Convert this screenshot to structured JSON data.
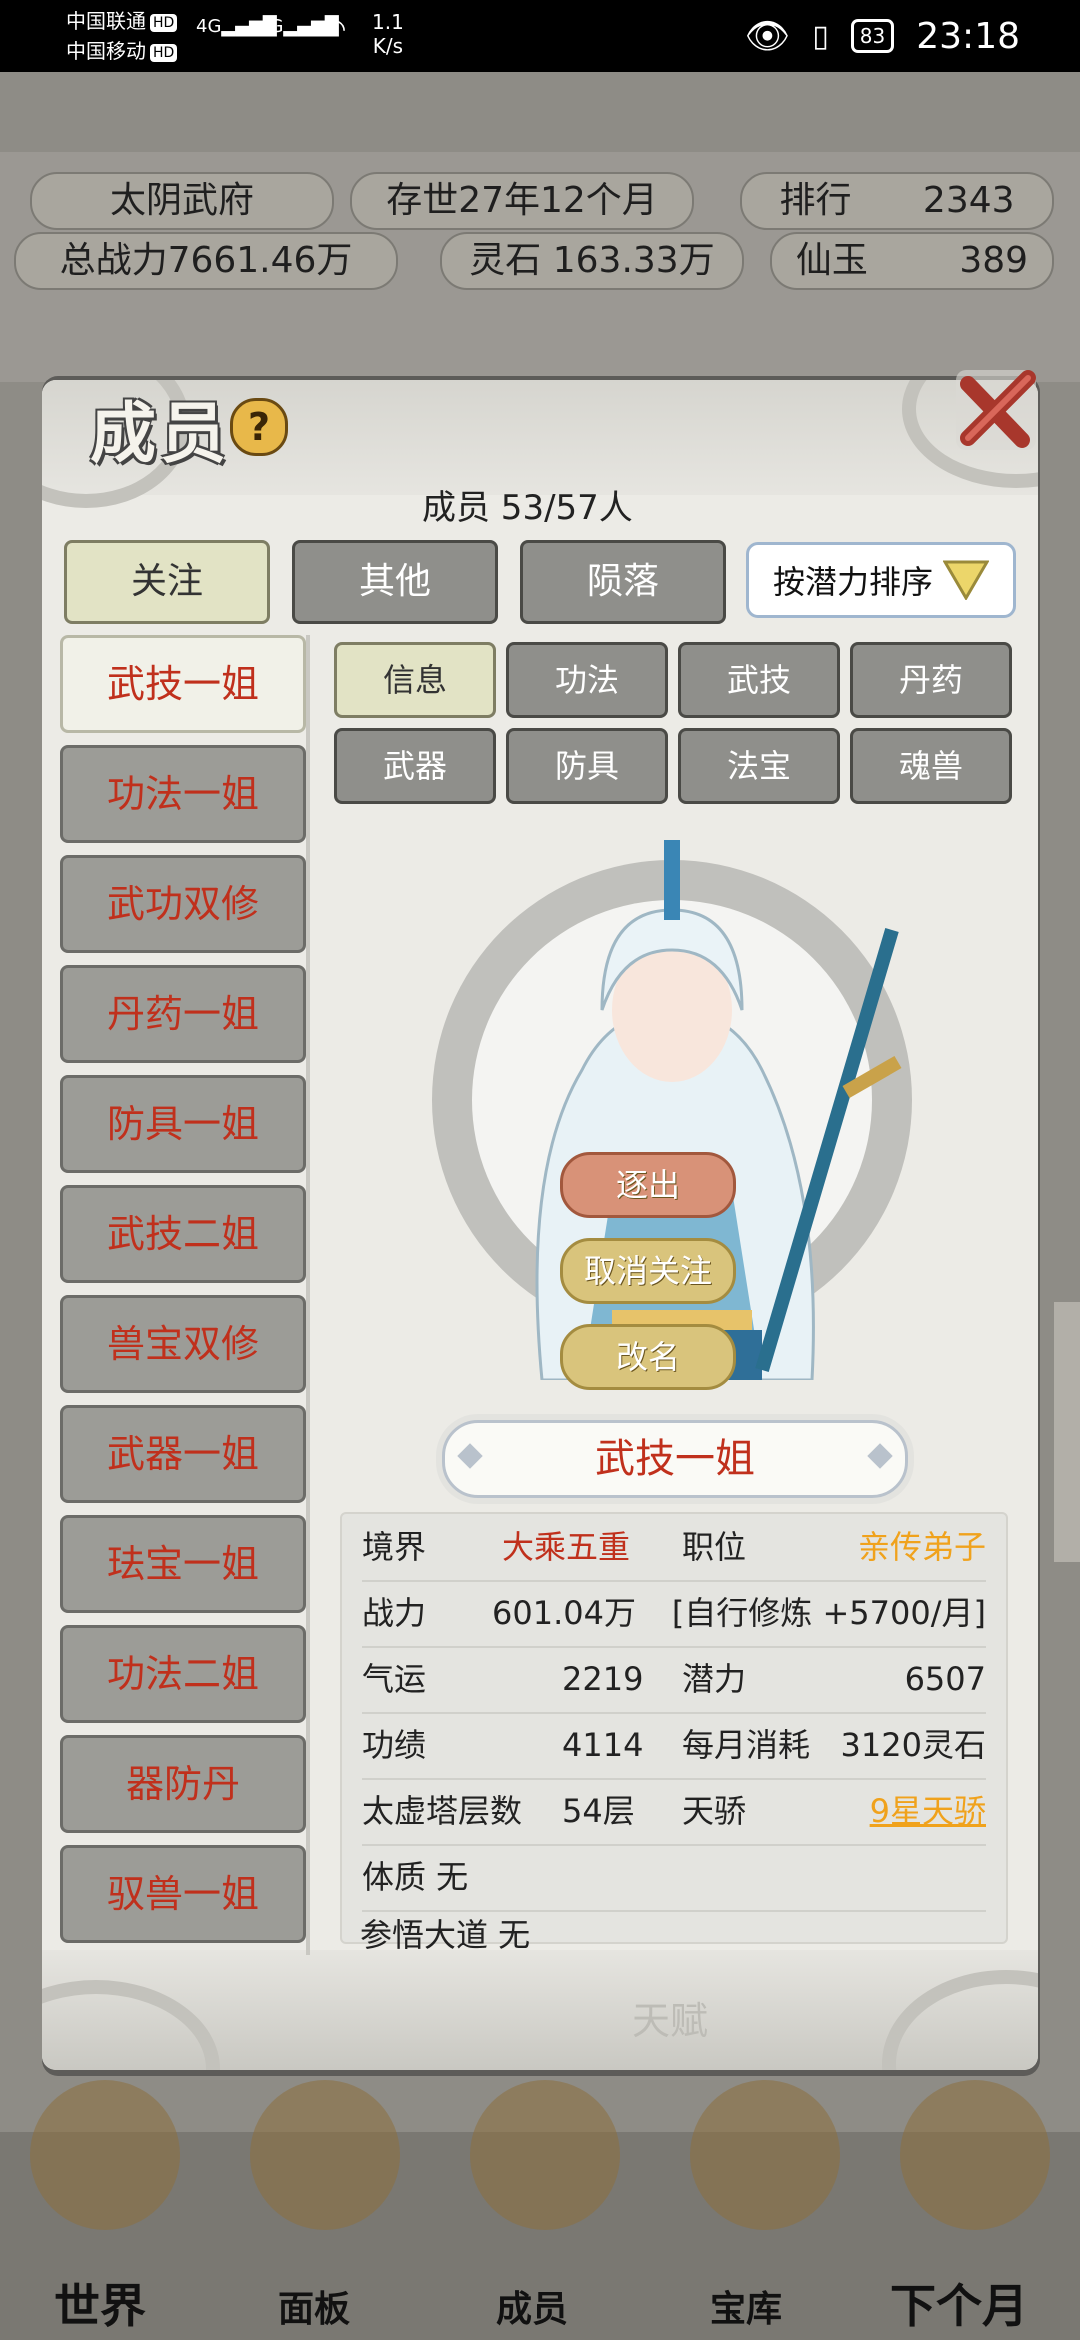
{
  "status_bar": {
    "carrier1": "中国联通",
    "carrier2": "中国移动",
    "hd": "HD",
    "net1": "4G",
    "net2": "4G",
    "speed_value": "1.1",
    "speed_unit": "K/s",
    "battery": "83",
    "time": "23:18"
  },
  "background": {
    "sect_name": "太阴武府",
    "age": "存世27年12个月",
    "rank_label": "排行",
    "rank_value": "2343",
    "power_label": "总战力7661.46万",
    "spirit_stone": "灵石 163.33万",
    "immortal_jade_label": "仙玉",
    "immortal_jade_value": "389",
    "nav": [
      "世界",
      "面板",
      "成员",
      "宝库",
      "下个月"
    ],
    "ghost_text": "天赋"
  },
  "panel": {
    "title": "成员",
    "help": "?",
    "member_count": "成员  53/57人",
    "tabs": [
      {
        "label": "关注",
        "active": true
      },
      {
        "label": "其他",
        "active": false
      },
      {
        "label": "陨落",
        "active": false
      }
    ],
    "sort_label": "按潜力排序",
    "members": [
      "武技一姐",
      "功法一姐",
      "武功双修",
      "丹药一姐",
      "防具一姐",
      "武技二姐",
      "兽宝双修",
      "武器一姐",
      "珐宝一姐",
      "功法二姐",
      "器防丹",
      "驭兽一姐"
    ],
    "sub_tabs": [
      "信息",
      "功法",
      "武技",
      "丹药",
      "武器",
      "防具",
      "法宝",
      "魂兽"
    ],
    "actions": {
      "expel": "逐出",
      "unfollow": "取消关注",
      "rename": "改名"
    },
    "selected_name": "武技一姐",
    "stats": {
      "realm_label": "境界",
      "realm_value": "大乘五重",
      "position_label": "职位",
      "position_value": "亲传弟子",
      "power_label": "战力",
      "power_value": "601.04万",
      "power_note": "[自行修炼 +5700/月]",
      "luck_label": "气运",
      "luck_value": "2219",
      "potential_label": "潜力",
      "potential_value": "6507",
      "merit_label": "功绩",
      "merit_value": "4114",
      "monthly_cost_label": "每月消耗",
      "monthly_cost_value": "3120灵石",
      "tower_label": "太虚塔层数",
      "tower_value": "54层",
      "prodigy_label": "天骄",
      "prodigy_value": "9星天骄",
      "constitution": "体质 无",
      "comprehension": "参悟大道 无"
    }
  },
  "colors": {
    "accent_red": "#c0301c",
    "accent_orange": "#f0a21c",
    "tab_active": "#e2e3c5"
  }
}
